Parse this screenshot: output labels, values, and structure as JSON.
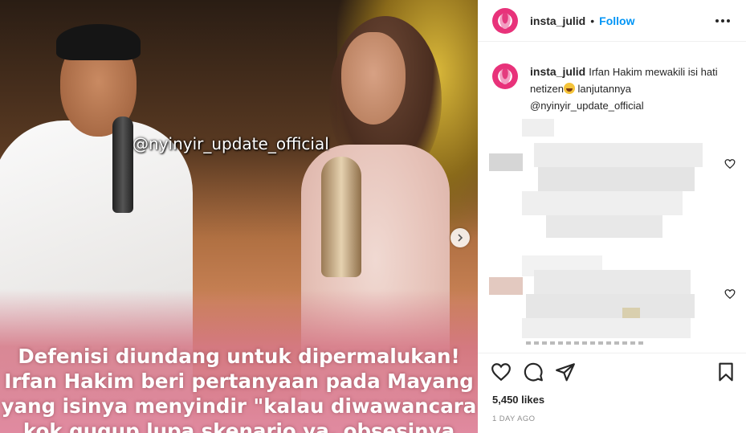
{
  "post": {
    "watermark": "@nyinyir_update_official",
    "overlay_lines": [
      "Defenisi diundang untuk dipermalukan!",
      "Irfan Hakim beri pertanyaan pada Mayang",
      "yang isinya menyindir \"kalau diwawancara",
      "kok gugup lupa skenario ya, obsesinya"
    ]
  },
  "header": {
    "username": "insta_julid",
    "separator": "•",
    "follow_label": "Follow",
    "more_icon": "more-horizontal-icon"
  },
  "caption": {
    "username": "insta_julid",
    "text_before_emoji": "Irfan Hakim mewakili isi hati netizen",
    "emoji": "grinning-sweat-emoji",
    "text_after_emoji": " lanjutannya @nyinyir_update_official"
  },
  "actions": {
    "icons": [
      "heart-icon",
      "comment-icon",
      "share-icon",
      "bookmark-icon"
    ],
    "likes": "5,450 likes",
    "time": "1 DAY AGO"
  },
  "colors": {
    "accent": "#0095f6",
    "text": "#262626",
    "muted": "#8e8e8e"
  }
}
